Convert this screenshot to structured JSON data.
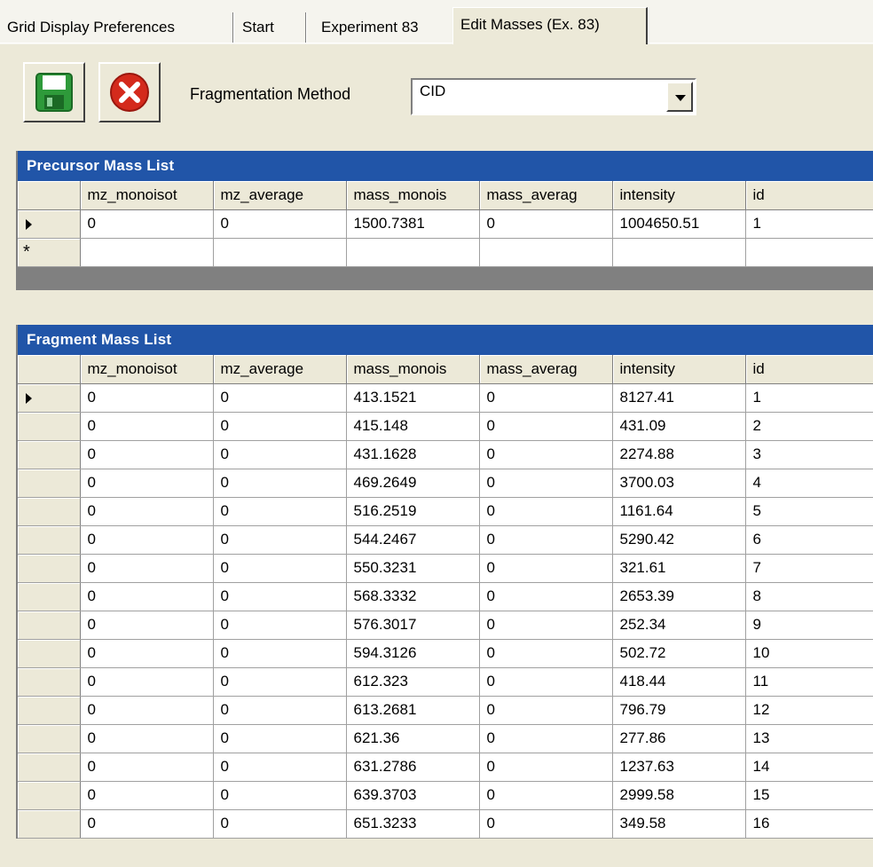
{
  "tabs": [
    "Grid Display Preferences",
    "Start",
    "Experiment 83",
    "Edit Masses (Ex. 83)"
  ],
  "toolbar": {
    "save_icon": "save-floppy-icon",
    "cancel_icon": "cancel-x-icon",
    "fragmentation_label": "Fragmentation Method",
    "fragmentation_value": "CID"
  },
  "colors": {
    "caption_bg": "#2155a8",
    "save_green": "#2e9a3a",
    "cancel_red": "#d42a1c"
  },
  "precursor": {
    "caption": "Precursor Mass List",
    "columns": [
      "mz_monoisot",
      "mz_average",
      "mass_monois",
      "mass_averag",
      "intensity",
      "id"
    ],
    "rows": [
      [
        "0",
        "0",
        "1500.7381",
        "0",
        "1004650.51",
        "1"
      ]
    ],
    "new_row_marker": "*"
  },
  "fragment": {
    "caption": "Fragment Mass List",
    "columns": [
      "mz_monoisot",
      "mz_average",
      "mass_monois",
      "mass_averag",
      "intensity",
      "id"
    ],
    "rows": [
      [
        "0",
        "0",
        "413.1521",
        "0",
        "8127.41",
        "1"
      ],
      [
        "0",
        "0",
        "415.148",
        "0",
        "431.09",
        "2"
      ],
      [
        "0",
        "0",
        "431.1628",
        "0",
        "2274.88",
        "3"
      ],
      [
        "0",
        "0",
        "469.2649",
        "0",
        "3700.03",
        "4"
      ],
      [
        "0",
        "0",
        "516.2519",
        "0",
        "1161.64",
        "5"
      ],
      [
        "0",
        "0",
        "544.2467",
        "0",
        "5290.42",
        "6"
      ],
      [
        "0",
        "0",
        "550.3231",
        "0",
        "321.61",
        "7"
      ],
      [
        "0",
        "0",
        "568.3332",
        "0",
        "2653.39",
        "8"
      ],
      [
        "0",
        "0",
        "576.3017",
        "0",
        "252.34",
        "9"
      ],
      [
        "0",
        "0",
        "594.3126",
        "0",
        "502.72",
        "10"
      ],
      [
        "0",
        "0",
        "612.323",
        "0",
        "418.44",
        "11"
      ],
      [
        "0",
        "0",
        "613.2681",
        "0",
        "796.79",
        "12"
      ],
      [
        "0",
        "0",
        "621.36",
        "0",
        "277.86",
        "13"
      ],
      [
        "0",
        "0",
        "631.2786",
        "0",
        "1237.63",
        "14"
      ],
      [
        "0",
        "0",
        "639.3703",
        "0",
        "2999.58",
        "15"
      ],
      [
        "0",
        "0",
        "651.3233",
        "0",
        "349.58",
        "16"
      ]
    ]
  }
}
